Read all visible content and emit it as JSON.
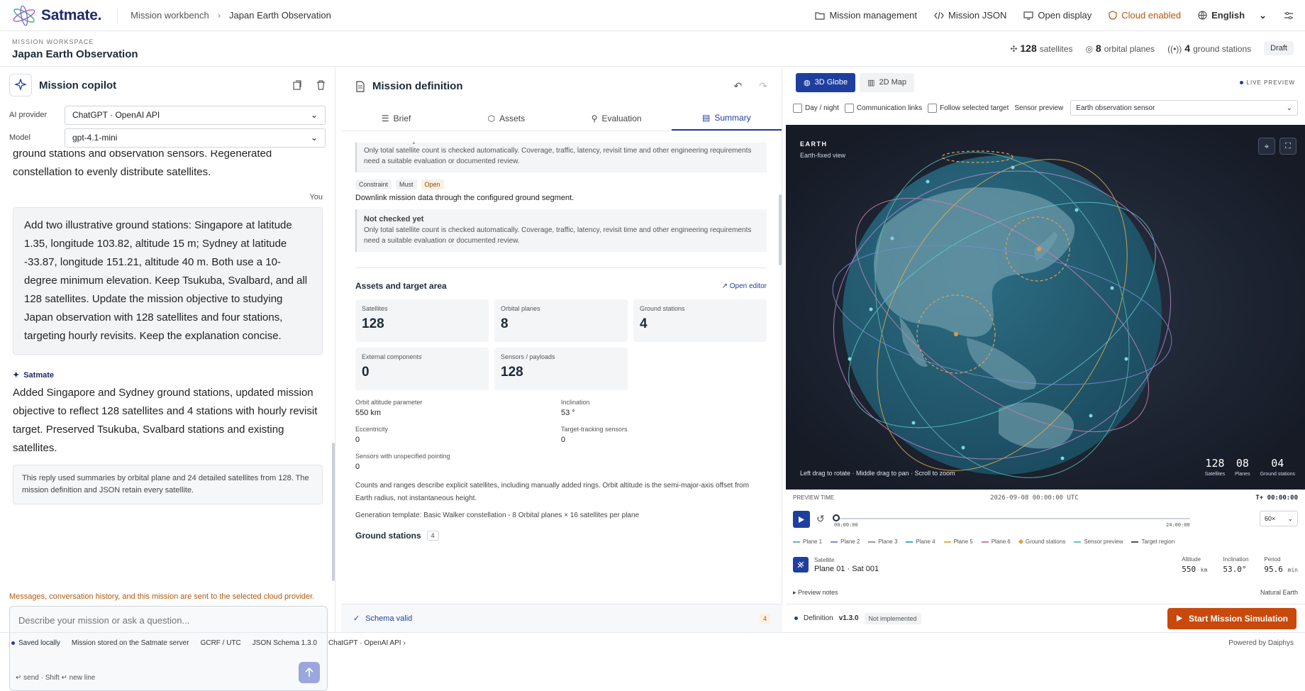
{
  "header": {
    "logo": "Satmate.",
    "breadcrumb": [
      "Mission workbench",
      "Japan Earth Observation"
    ],
    "nav": {
      "mission_management": "Mission management",
      "mission_json": "Mission JSON",
      "open_display": "Open display",
      "cloud": "Cloud enabled",
      "language": "English"
    }
  },
  "subheader": {
    "workspace_label": "MISSION WORKSPACE",
    "project": "Japan Earth Observation",
    "satellites_n": "128",
    "satellites_l": "satellites",
    "planes_n": "8",
    "planes_l": "orbital planes",
    "stations_n": "4",
    "stations_l": "ground stations",
    "status": "Draft"
  },
  "copilot": {
    "title": "Mission copilot",
    "provider_label": "AI provider",
    "provider_value": "ChatGPT · OpenAI API",
    "model_label": "Model",
    "model_value": "gpt-4.1-mini",
    "prev_tail": "ground stations and observation sensors. Regenerated constellation to evenly distribute satellites.",
    "you_label": "You",
    "user_message": "Add two illustrative ground stations: Singapore at latitude 1.35, longitude 103.82, altitude 15 m; Sydney at latitude -33.87, longitude 151.21, altitude 40 m. Both use a 10-degree minimum elevation. Keep Tsukuba, Svalbard, and all 128 satellites. Update the mission objective to studying Japan observation with 128 satellites and four stations, targeting hourly revisits. Keep the explanation concise.",
    "assistant_label": "Satmate",
    "assistant_message": "Added Singapore and Sydney ground stations, updated mission objective to reflect 128 satellites and 4 stations with hourly revisit target. Preserved Tsukuba, Svalbard stations and existing satellites.",
    "reply_note": "This reply used summaries by orbital plane and 24 detailed satellites from 128. The mission definition and JSON retain every satellite.",
    "privacy_warning": "Messages, conversation history, and this mission are sent to the selected cloud provider.",
    "input_placeholder": "Describe your mission or ask a question...",
    "input_hint": "↵ send · Shift ↵ new line"
  },
  "definition": {
    "title": "Mission definition",
    "tabs": [
      "Brief",
      "Assets",
      "Evaluation",
      "Summary"
    ],
    "not_checked_title": "Not checked yet",
    "not_checked_desc": "Only total satellite count is checked automatically. Coverage, traffic, latency, revisit time and other engineering requirements need a suitable evaluation or documented review.",
    "tags": [
      "Constraint",
      "Must",
      "Open"
    ],
    "requirement": "Downlink mission data through the configured ground segment.",
    "assets_title": "Assets and target area",
    "open_editor": "Open editor",
    "cards": [
      {
        "label": "Satellites",
        "value": "128"
      },
      {
        "label": "Orbital planes",
        "value": "8"
      },
      {
        "label": "Ground stations",
        "value": "4"
      },
      {
        "label": "External components",
        "value": "0"
      },
      {
        "label": "Sensors / payloads",
        "value": "128"
      }
    ],
    "params": [
      {
        "label": "Orbit altitude parameter",
        "value": "550 km"
      },
      {
        "label": "Inclination",
        "value": "53 °"
      },
      {
        "label": "Eccentricity",
        "value": "0"
      },
      {
        "label": "Target-tracking sensors",
        "value": "0"
      },
      {
        "label": "Sensors with unspecified pointing",
        "value": "0"
      }
    ],
    "counts_note": "Counts and ranges describe explicit satellites, including manually added rings. Orbit altitude is the semi-major-axis offset from Earth radius, not instantaneous height.",
    "template_note": "Generation template: Basic Walker constellation - 8 Orbital planes × 16 satellites per plane",
    "ground_title": "Ground stations",
    "ground_count": "4",
    "schema": "Schema valid",
    "schema_count": "4"
  },
  "preview": {
    "view_3d": "3D Globe",
    "view_2d": "2D Map",
    "live": "LIVE PREVIEW",
    "opt_daynight": "Day / night",
    "opt_comm": "Communication links",
    "opt_follow": "Follow selected target",
    "sensor_label": "Sensor preview",
    "sensor_value": "Earth observation sensor",
    "globe_title": "EARTH",
    "globe_sub": "Earth-fixed view",
    "globe_hint": "Left drag to rotate · Middle drag to pan · Scroll to zoom",
    "gstats": [
      {
        "n": "128",
        "c": "Satellites"
      },
      {
        "n": "08",
        "c": "Planes"
      },
      {
        "n": "04",
        "c": "Ground stations"
      }
    ],
    "ptime_label": "PREVIEW TIME",
    "ptime_value": "2026-09-08 00:00:00",
    "ptime_tz": "UTC",
    "ptime_offset": "T+ 00:00:00",
    "t_start": "00:00:00",
    "t_end": "24:00:00",
    "progress": 0.0,
    "speed": "60×",
    "legend": [
      {
        "name": "Plane 1",
        "color": "#5fb8b0"
      },
      {
        "name": "Plane 2",
        "color": "#7a8fd0"
      },
      {
        "name": "Plane 3",
        "color": "#999999"
      },
      {
        "name": "Plane 4",
        "color": "#3fb0c0"
      },
      {
        "name": "Plane 5",
        "color": "#e0b050"
      },
      {
        "name": "Plane 6",
        "color": "#d080b0"
      },
      {
        "name": "Ground stations",
        "color": "#e59a3c"
      },
      {
        "name": "Sensor preview",
        "color": "#5fc8c8"
      },
      {
        "name": "Target region",
        "color": "#555555"
      }
    ],
    "sat_label": "Satellite",
    "sat_name": "Plane 01 · Sat 001",
    "metrics": [
      {
        "l": "Altitude",
        "v": "550",
        "u": "km"
      },
      {
        "l": "Inclination",
        "v": "53.0°",
        "u": ""
      },
      {
        "l": "Period",
        "v": "95.6",
        "u": "min"
      }
    ],
    "notes": "Preview notes",
    "basemap": "Natural Earth",
    "definition_label": "Definition",
    "version": "v1.3.0",
    "not_impl": "Not implemented",
    "start": "Start Mission Simulation"
  },
  "status": {
    "saved": "Saved locally",
    "stored": "Mission stored on the Satmate server",
    "frame": "GCRF / UTC",
    "schema": "JSON Schema 1.3.0",
    "provider": "ChatGPT · OpenAI API",
    "powered": "Powered by Daiphys"
  }
}
